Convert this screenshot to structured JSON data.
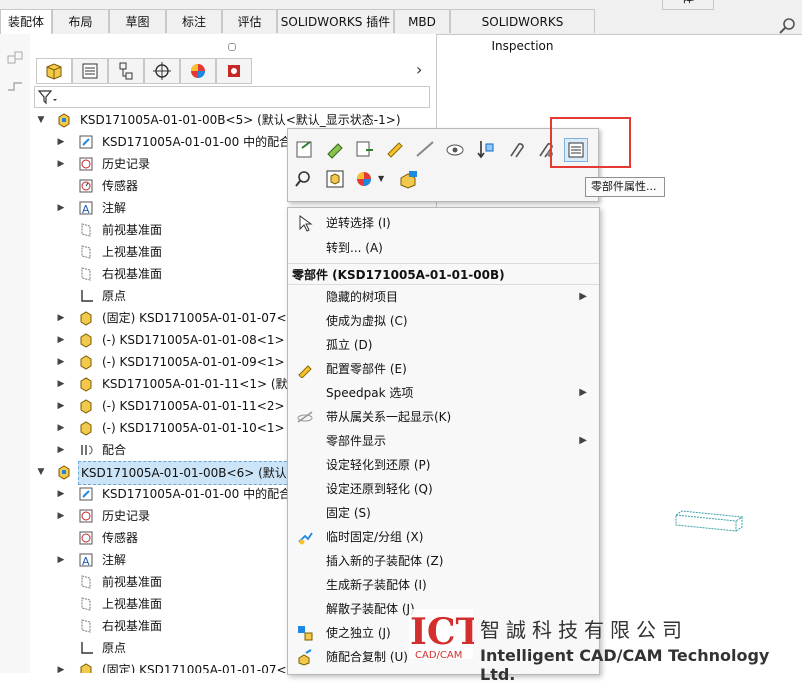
{
  "tabs": [
    "装配体",
    "布局",
    "草图",
    "标注",
    "评估",
    "SOLIDWORKS 插件",
    "MBD",
    "SOLIDWORKS Inspection"
  ],
  "right_tab": "体",
  "tree": {
    "root1": "KSD171005A-01-01-00B<5> (默认<默认_显示状态-1>)",
    "items1": [
      "KSD171005A-01-01-00 中的配合",
      "历史记录",
      "传感器",
      "注解",
      "前视基准面",
      "上视基准面",
      "右视基准面",
      "原点",
      "(固定) KSD171005A-01-01-07<1",
      "(-) KSD171005A-01-01-08<1> (默",
      "(-) KSD171005A-01-01-09<1> (默",
      "KSD171005A-01-01-11<1> (默认",
      "(-) KSD171005A-01-01-11<2> (默",
      "(-) KSD171005A-01-01-10<1> (默",
      "配合"
    ],
    "root2": "KSD171005A-01-01-00B<6> (默认<默",
    "items2": [
      "KSD171005A-01-01-00 中的配合",
      "历史记录",
      "传感器",
      "注解",
      "前视基准面",
      "上视基准面",
      "右视基准面",
      "原点",
      "(固定) KSD171005A-01-01-07<1"
    ]
  },
  "tooltip": "零部件属性...",
  "menu": {
    "top": [
      "逆转选择 (I)",
      "转到... (A)"
    ],
    "header": "零部件 (KSD171005A-01-01-00B)",
    "items": [
      "隐藏的树项目",
      "使成为虚拟 (C)",
      "孤立 (D)",
      "配置零部件 (E)",
      "Speedpak 选项",
      "带从属关系一起显示(K)",
      "零部件显示",
      "设定轻化到还原 (P)",
      "设定还原到轻化 (Q)",
      "固定 (S)",
      "临时固定/分组 (X)",
      "插入新的子装配体 (Z)",
      "生成新子装配体 (I)",
      "解散子装配体 (J)",
      "使之独立 (J)",
      "随配合复制 (U)"
    ]
  },
  "watermark": {
    "logo_main": "ICT",
    "logo_sub": "CAD/CAM",
    "cn": "智誠科技有限公司",
    "en": "Intelligent CAD/CAM Technology Ltd."
  },
  "colors": {
    "highlight": "#e53935",
    "selection": "#cce4f7",
    "logo_red": "#d32f2f"
  }
}
